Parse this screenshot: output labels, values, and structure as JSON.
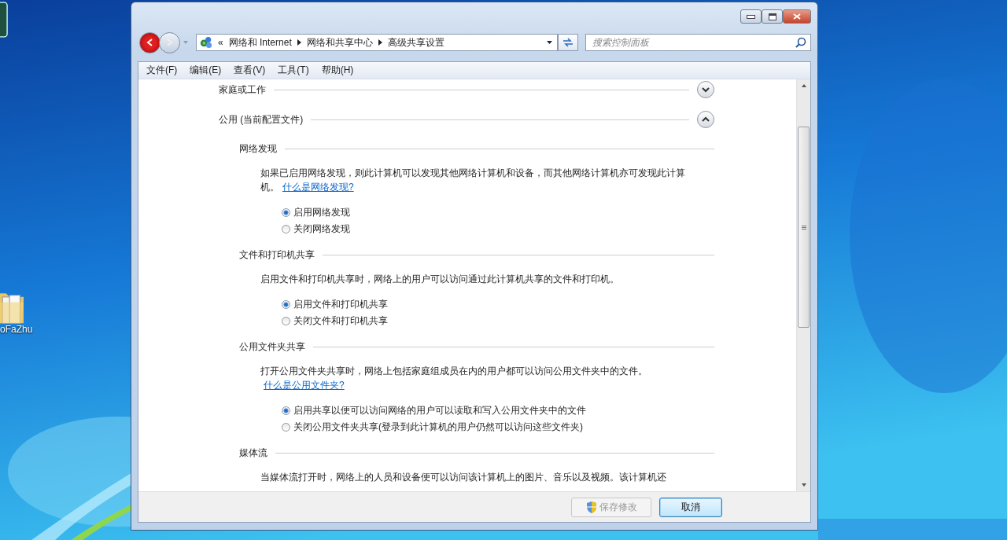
{
  "desktop": {
    "icons": [
      {
        "kind": "app"
      },
      {
        "kind": "folder",
        "label": "oFaZhu"
      }
    ]
  },
  "window": {
    "nav": {
      "overflow": "«",
      "path": [
        "网络和 Internet",
        "网络和共享中心",
        "高级共享设置"
      ]
    },
    "search": {
      "placeholder": "搜索控制面板"
    },
    "menu": [
      "文件(F)",
      "编辑(E)",
      "查看(V)",
      "工具(T)",
      "帮助(H)"
    ],
    "profiles": [
      {
        "title": "家庭或工作",
        "expanded": false
      },
      {
        "title": "公用 (当前配置文件)",
        "expanded": true,
        "sections": [
          {
            "title": "网络发现",
            "description": "如果已启用网络发现，则此计算机可以发现其他网络计算机和设备，而其他网络计算机亦可发现此计算机。",
            "link": "什么是网络发现?",
            "options": [
              {
                "label": "启用网络发现",
                "selected": true
              },
              {
                "label": "关闭网络发现",
                "selected": false
              }
            ]
          },
          {
            "title": "文件和打印机共享",
            "description": "启用文件和打印机共享时，网络上的用户可以访问通过此计算机共享的文件和打印机。",
            "options": [
              {
                "label": "启用文件和打印机共享",
                "selected": true
              },
              {
                "label": "关闭文件和打印机共享",
                "selected": false
              }
            ]
          },
          {
            "title": "公用文件夹共享",
            "description": "打开公用文件夹共享时，网络上包括家庭组成员在内的用户都可以访问公用文件夹中的文件。",
            "link": "什么是公用文件夹?",
            "options": [
              {
                "label": "启用共享以便可以访问网络的用户可以读取和写入公用文件夹中的文件",
                "selected": true
              },
              {
                "label": "关闭公用文件夹共享(登录到此计算机的用户仍然可以访问这些文件夹)",
                "selected": false
              }
            ]
          },
          {
            "title": "媒体流",
            "description": "当媒体流打开时，网络上的人员和设备便可以访问该计算机上的图片、音乐以及视频。该计算机还"
          }
        ]
      }
    ],
    "buttons": [
      {
        "label": "保存修改",
        "disabled": true,
        "shield": true
      },
      {
        "label": "取消",
        "disabled": false,
        "shield": false
      }
    ]
  }
}
